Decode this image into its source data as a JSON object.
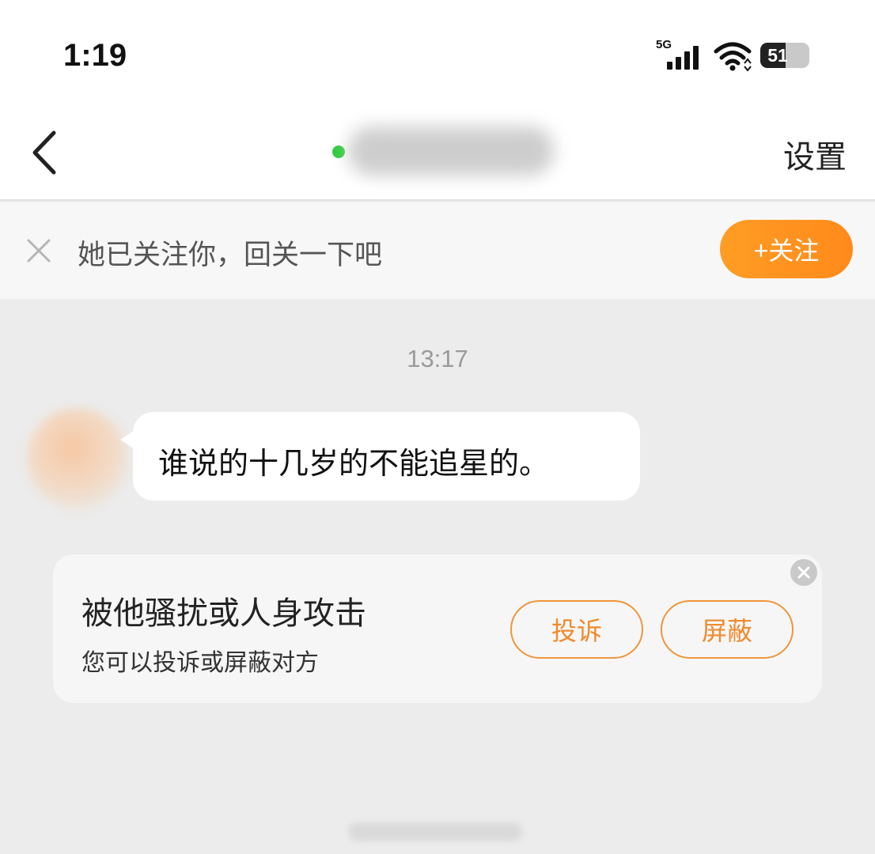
{
  "status_bar": {
    "time": "1:19",
    "network": "5G",
    "battery_level": "51",
    "battery_fraction": 0.51
  },
  "nav": {
    "settings_label": "设置"
  },
  "follow_prompt": {
    "text": "她已关注你，回关一下吧",
    "button_label": "+关注"
  },
  "chat": {
    "timestamp": "13:17",
    "messages": [
      {
        "text": "谁说的十几岁的不能追星的。"
      }
    ]
  },
  "harassment_card": {
    "title": "被他骚扰或人身攻击",
    "subtitle": "您可以投诉或屏蔽对方",
    "report_label": "投诉",
    "block_label": "屏蔽"
  },
  "colors": {
    "accent": "#ff9320",
    "online": "#2ecc3a",
    "background": "#ececec"
  }
}
